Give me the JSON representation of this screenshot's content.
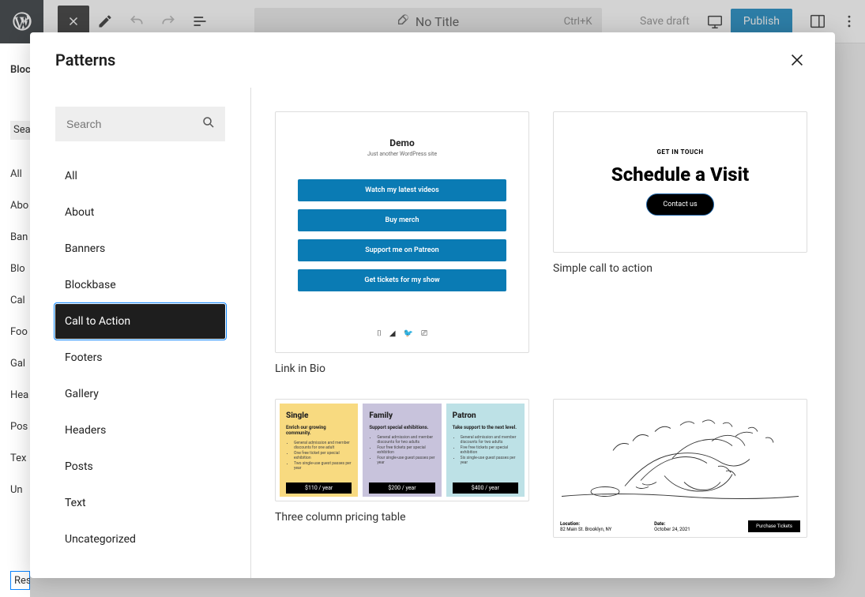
{
  "topbar": {
    "title": "No Title",
    "shortcut": "Ctrl+K",
    "save_draft": "Save draft",
    "publish": "Publish"
  },
  "under_sidebar": [
    "Block",
    "Sear",
    "All",
    "Abo",
    "Ban",
    "Blo",
    "Cal",
    "Foo",
    "Gal",
    "Hea",
    "Pos",
    "Tex",
    "Un",
    "Res"
  ],
  "modal": {
    "title": "Patterns",
    "search_placeholder": "Search"
  },
  "categories": [
    "All",
    "About",
    "Banners",
    "Blockbase",
    "Call to Action",
    "Footers",
    "Gallery",
    "Headers",
    "Posts",
    "Text",
    "Uncategorized"
  ],
  "active_category": "Call to Action",
  "patterns": {
    "link_in_bio": {
      "label": "Link in Bio",
      "site_title": "Demo",
      "tagline": "Just another WordPress site",
      "buttons": [
        "Watch my latest videos",
        "Buy merch",
        "Support me on Patreon",
        "Get tickets for my show"
      ]
    },
    "simple_cta": {
      "label": "Simple call to action",
      "eyebrow": "GET IN TOUCH",
      "heading": "Schedule a Visit",
      "button": "Contact us"
    },
    "pricing": {
      "label": "Three column pricing table",
      "cols": [
        {
          "name": "Single",
          "sub": "Enrich our growing community.",
          "price": "$110 / year",
          "items": [
            "General admission and member discounts for one adult",
            "One free ticket per special exhibition",
            "Two single-use guest passes per year"
          ]
        },
        {
          "name": "Family",
          "sub": "Support special exhibitions.",
          "price": "$200 / year",
          "items": [
            "General admission and member discounts for two adults",
            "Four free tickets per special exhibition",
            "Four single-use guest passes per year"
          ]
        },
        {
          "name": "Patron",
          "sub": "Take support to the next level.",
          "price": "$400 / year",
          "items": [
            "General admission and member discounts for two adults",
            "Five free tickets per special exhibition",
            "Six single-use guest passes per year"
          ]
        }
      ]
    },
    "tickets": {
      "loc_label": "Location:",
      "loc": "82 Main St. Brooklyn, NY",
      "date_label": "Date:",
      "date": "October 24, 2021",
      "button": "Purchase Tickets"
    }
  }
}
